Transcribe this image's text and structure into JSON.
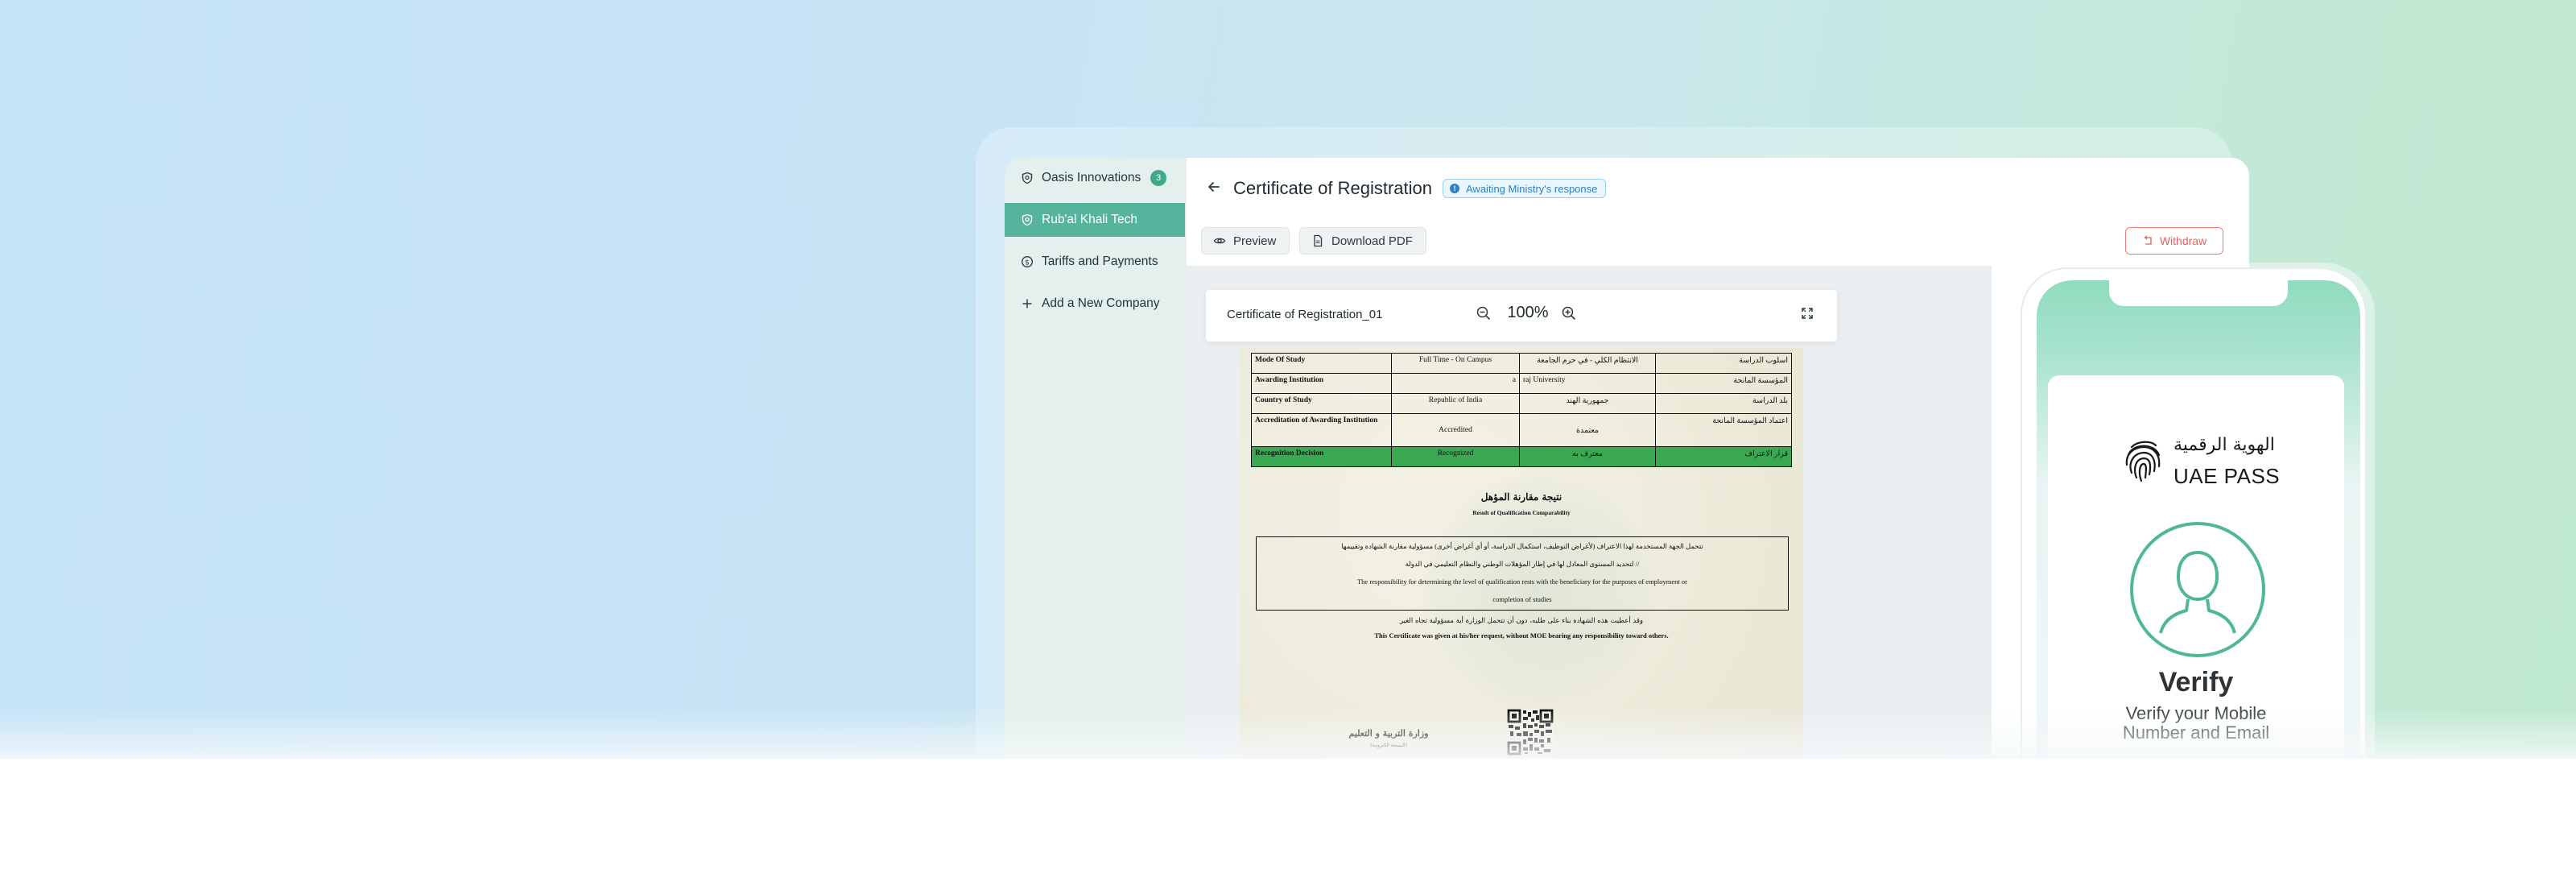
{
  "sidebar": {
    "items": [
      {
        "label": "Oasis Innovations",
        "badge": "3",
        "icon": "shield-icon"
      },
      {
        "label": "Rub'al Khali Tech",
        "icon": "shield-icon"
      },
      {
        "label": "Tariffs and Payments",
        "icon": "dollar-icon"
      },
      {
        "label": "Add a New Company",
        "icon": "plus-icon"
      }
    ]
  },
  "header": {
    "title": "Certificate of Registration",
    "status": "Awaiting Ministry's response",
    "status_icon_glyph": "!"
  },
  "toolbar": {
    "preview_label": "Preview",
    "download_label": "Download PDF",
    "withdraw_label": "Withdraw"
  },
  "viewer": {
    "doc_name": "Certificate of Registration_01",
    "zoom": "100%"
  },
  "document": {
    "rows": [
      {
        "en": "Mode Of Study",
        "value_en": "Full Time - On Campus",
        "value_ar": "الانتظام الكلي - في حرم الجامعة",
        "ar": "اسلوب الدراسة"
      },
      {
        "en": "Awarding Institution",
        "value_en": "a",
        "value_ar": "raj University",
        "ar": "المؤسسة المانحة"
      },
      {
        "en": "Country of Study",
        "value_en": "Republic of India",
        "value_ar": "جمهورية الهند",
        "ar": "بلد الدراسة"
      },
      {
        "en": "Accreditation of Awarding Institution",
        "value_en": "Accredited",
        "value_ar": "معتمدة",
        "ar": "اعتماد المؤسسة المانحة"
      },
      {
        "en": "Recognition Decision",
        "value_en": "Recognized",
        "value_ar": "معترف به",
        "ar": "قرار الاعتراف"
      }
    ],
    "result_title_ar": "نتيجة مقارنة المؤهل",
    "result_title_en": "Result of Qualification Comparability",
    "box_lines": [
      "تتحمل الجهة المستخدمة لهذا الاعتراف (لأغراض التوظيف، استكمال الدراسة، أو أي أغراض أخرى) مسؤولية مقارنة الشهادة وتقييمها",
      "لتحديد المستوى المعادل لها في إطار المؤهلات الوطني والنظام التعليمي في الدولة //",
      "The responsibility for determining the level of qualification rests with the beneficiary for the purposes of employment or",
      "completion of studies"
    ],
    "note_ar": "وقد أعطيت هذه الشهادة بناء على طلبه، دون أن تتحمل الوزارة أية مسؤولية تجاه الغير",
    "note_en": "This Certificate was given at his/her request, without MOE bearing any responsibility toward others.",
    "ministry_ar": "وزارة التربية و التعليم",
    "ministry_sub_ar": "(النسخة الكترونية)"
  },
  "phone": {
    "brand_ar": "الهوية الرقمية",
    "brand_en": "UAE PASS",
    "verify_title": "Verify",
    "verify_sub_1": "Verify your Mobile",
    "verify_sub_2": "Number and Email"
  },
  "colors": {
    "accent": "#57b49c",
    "badge": "#3fa98a",
    "status_blue": "#2a83c4",
    "withdraw_red": "#e35f5f",
    "recognition_green": "#3aa850",
    "phone_teal": "#4fb69a"
  }
}
